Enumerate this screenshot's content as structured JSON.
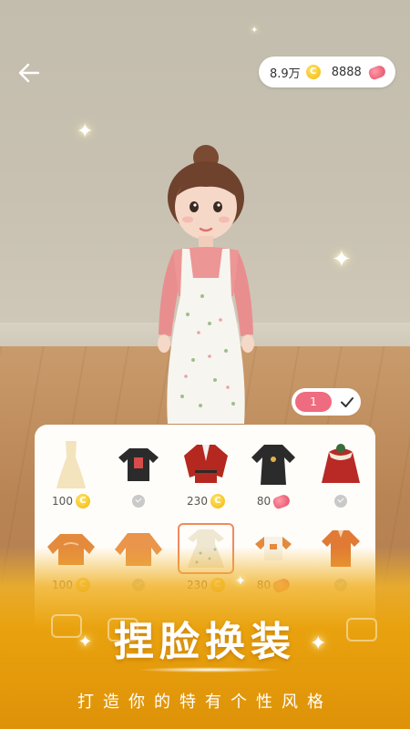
{
  "header": {
    "coins": "8.9万",
    "coin_symbol": "C",
    "beans": "8888"
  },
  "confirm": {
    "quantity": "1"
  },
  "wardrobe": {
    "items": [
      {
        "name": "cream-gown",
        "price": "100",
        "currency": "coin"
      },
      {
        "name": "black-graphic-tee",
        "price": "",
        "currency": "owned"
      },
      {
        "name": "red-blazer",
        "price": "230",
        "currency": "coin"
      },
      {
        "name": "black-dress",
        "price": "80",
        "currency": "bean"
      },
      {
        "name": "red-cape",
        "price": "",
        "currency": "owned"
      },
      {
        "name": "orange-sweater",
        "price": "100",
        "currency": "coin"
      },
      {
        "name": "orange-shirt",
        "price": "",
        "currency": "owned"
      },
      {
        "name": "cream-dress",
        "price": "230",
        "currency": "coin"
      },
      {
        "name": "orange-crop-top",
        "price": "80",
        "currency": "bean"
      },
      {
        "name": "orange-blouse",
        "price": "",
        "currency": "owned"
      }
    ]
  },
  "banner": {
    "title": "捏脸换装",
    "subtitle": "打造你的特有个性风格"
  },
  "colors": {
    "accent_pink": "#ef6b7f",
    "banner_gold": "#e9a20e",
    "coin_yellow": "#f2b807"
  }
}
